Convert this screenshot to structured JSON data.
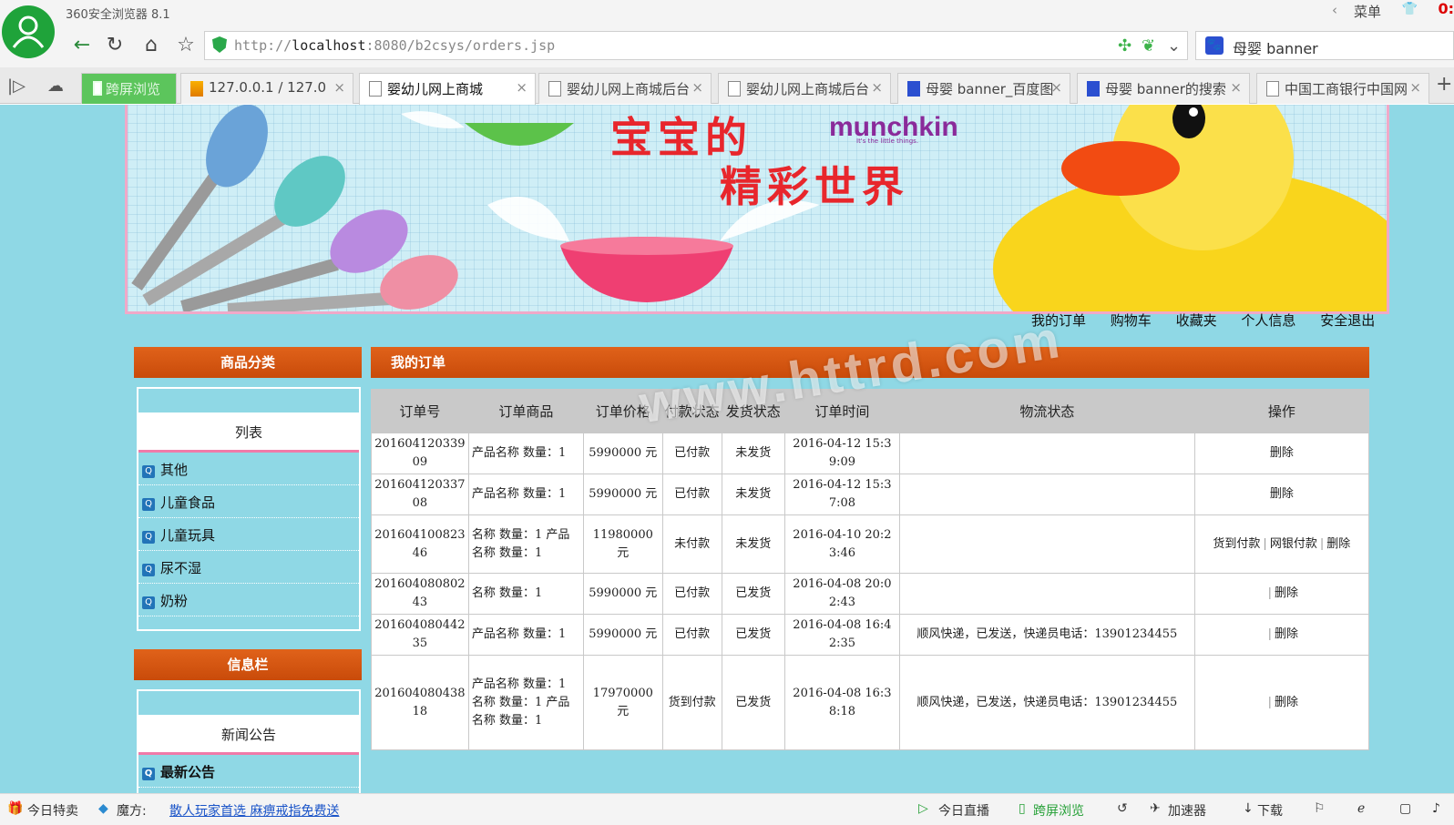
{
  "browser": {
    "app_title": "360安全浏览器 8.1",
    "menu_label": "菜单",
    "clock": "0:",
    "url_prefix": "http://",
    "url_host": "localhost",
    "url_rest": ":8080/b2csys/orders.jsp",
    "search_query": "母婴 banner",
    "tabs": [
      {
        "label": "跨屏浏览",
        "icon": "phone-icon"
      },
      {
        "label": "127.0.0.1 / 127.0",
        "icon": "phpmyadmin-icon"
      },
      {
        "label": "婴幼儿网上商城",
        "icon": "page-icon"
      },
      {
        "label": "婴幼儿网上商城后台",
        "icon": "page-icon"
      },
      {
        "label": "婴幼儿网上商城后台",
        "icon": "page-icon"
      },
      {
        "label": "母婴 banner_百度图",
        "icon": "baidu-paw-icon"
      },
      {
        "label": "母婴 banner的搜索",
        "icon": "baidu-paw-icon"
      },
      {
        "label": "中国工商银行中国网",
        "icon": "page-icon"
      }
    ]
  },
  "banner": {
    "slogan_line1": "宝宝的",
    "slogan_line2": "精彩世界",
    "brand": "munchkin",
    "brand_tagline": "It's the little things."
  },
  "top_nav": [
    "我的订单",
    "购物车",
    "收藏夹",
    "个人信息",
    "安全退出"
  ],
  "sidebar": {
    "category_header": "商品分类",
    "category_list_title": "列表",
    "categories": [
      "其他",
      "儿童食品",
      "儿童玩具",
      "尿不湿",
      "奶粉"
    ],
    "info_header": "信息栏",
    "news_title": "新闻公告",
    "news_items": [
      "最新公告"
    ]
  },
  "main": {
    "header": "我的订单",
    "columns": [
      "订单号",
      "订单商品",
      "订单价格",
      "付款状态",
      "发货状态",
      "订单时间",
      "物流状态",
      "操作"
    ],
    "rows": [
      {
        "id": "20160412033909",
        "items": "产品名称 数量：1",
        "price": "5990000 元",
        "pay": "已付款",
        "ship": "未发货",
        "time": "2016-04-12 15:39:09",
        "logistics": "",
        "actions": [
          "删除"
        ]
      },
      {
        "id": "20160412033708",
        "items": "产品名称 数量：1",
        "price": "5990000 元",
        "pay": "已付款",
        "ship": "未发货",
        "time": "2016-04-12 15:37:08",
        "logistics": "",
        "actions": [
          "删除"
        ]
      },
      {
        "id": "20160410082346",
        "items": "名称 数量：1 产品名称 数量：1",
        "price": "11980000 元",
        "pay": "未付款",
        "ship": "未发货",
        "time": "2016-04-10 20:23:46",
        "logistics": "",
        "actions": [
          "货到付款",
          "网银付款",
          "删除"
        ]
      },
      {
        "id": "20160408080243",
        "items": "名称 数量：1",
        "price": "5990000 元",
        "pay": "已付款",
        "ship": "已发货",
        "time": "2016-04-08 20:02:43",
        "logistics": "",
        "actions": [
          "删除"
        ]
      },
      {
        "id": "20160408044235",
        "items": "产品名称 数量：1",
        "price": "5990000 元",
        "pay": "已付款",
        "ship": "已发货",
        "time": "2016-04-08 16:42:35",
        "logistics": "顺风快递，已发送，快递员电话：13901234455",
        "actions": [
          "删除"
        ]
      },
      {
        "id": "20160408043818",
        "items": "产品名称 数量：1 名称 数量：1 产品名称 数量：1",
        "price": "17970000 元",
        "pay": "货到付款",
        "ship": "已发货",
        "time": "2016-04-08 16:38:18",
        "logistics": "顺风快递，已发送，快递员电话：13901234455",
        "actions": [
          "删除"
        ]
      }
    ]
  },
  "watermark": "www.httrd.com",
  "statusbar": {
    "today_deals": "今日特卖",
    "magic": "魔方:",
    "ad_link": "散人玩家首选 麻痹戒指免费送",
    "live": "今日直播",
    "cross_screen": "跨屏浏览",
    "accelerator": "加速器",
    "download": "下载"
  }
}
